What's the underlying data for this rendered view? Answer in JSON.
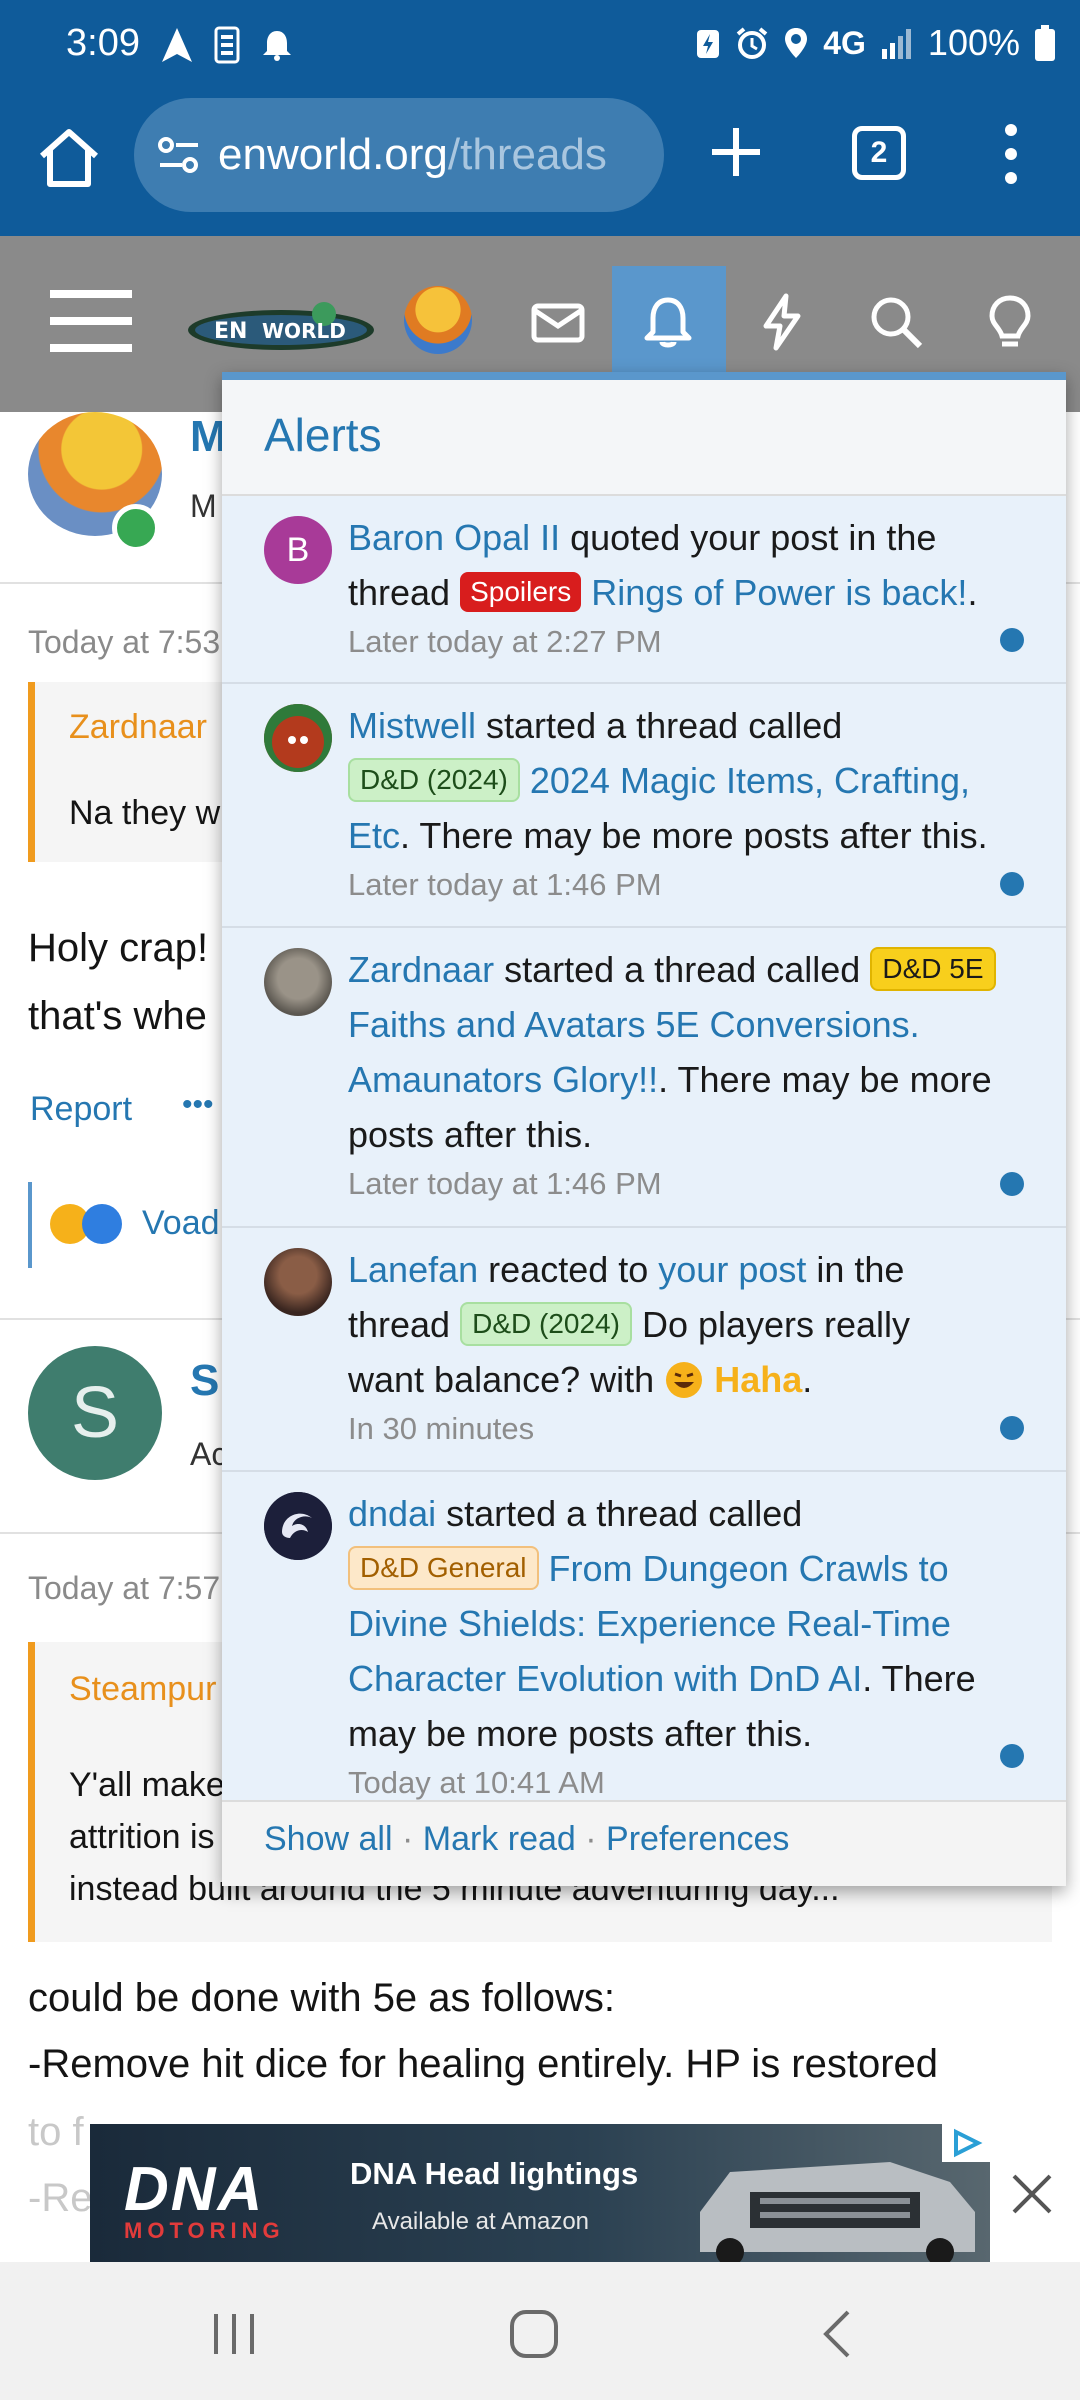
{
  "status_bar": {
    "time": "3:09",
    "network": "4G",
    "battery": "100%"
  },
  "browser": {
    "url_domain": "enworld.org",
    "url_path": "/threads",
    "tab_count": "2"
  },
  "page": {
    "post1": {
      "name_initial": "M",
      "role_initial": "M",
      "time": "Today at 7:53",
      "quote_author": "Zardnaar",
      "quote_text": "Na they w",
      "body_line1": "Holy crap!",
      "body_line2": "that's whe",
      "report_label": "Report",
      "more_label": "•••",
      "reaction_user": "Voad"
    },
    "post2": {
      "avatar_letter": "S",
      "name_initial": "S",
      "role_initial": "Ac",
      "time": "Today at 7:57",
      "quote_author": "Steampur",
      "quote_line1": "Y'all make",
      "quote_line2": "attrition is",
      "quote_line3": "instead built around the 5 minute adventuring day...",
      "body_line1": "could be done with 5e as follows:",
      "body_line2": "-Remove hit dice for healing entirely. HP is restored",
      "body_line3": "to f",
      "body_line4": "-Re"
    }
  },
  "alerts": {
    "title": "Alerts",
    "items": [
      {
        "avatar_letter": "B",
        "user": "Baron Opal II",
        "t1": "quoted your post in the thread",
        "tag": "Spoilers",
        "thread": "Rings of Power is back!",
        "tail": ".",
        "time": "Later today at 2:27 PM"
      },
      {
        "user": "Mistwell",
        "t1": "started a thread called",
        "tag": "D&D (2024)",
        "thread": "2024 Magic Items, Crafting, Etc",
        "tail": ". There may be more posts after this.",
        "time": "Later today at 1:46 PM"
      },
      {
        "user": "Zardnaar",
        "t1": "started a thread called",
        "tag": "D&D 5E",
        "thread": "Faiths and Avatars 5E Conversions. Amaunators Glory!!",
        "tail": ". There may be more posts after this.",
        "time": "Later today at 1:46 PM"
      },
      {
        "user": "Lanefan",
        "t1": "reacted to",
        "post_link": "your post",
        "t2": "in the thread",
        "tag": "D&D (2024)",
        "thread": "Do players really want balance? with",
        "reaction": "Haha",
        "tail": ".",
        "time": "In 30 minutes"
      },
      {
        "user": "dndai",
        "t1": "started a thread called",
        "tag": "D&D General",
        "thread": "From Dungeon Crawls to Divine Shields: Experience Real-Time Character Evolution with DnD AI",
        "tail": ". There may be more posts after this.",
        "time": "Today at 10:41 AM"
      }
    ],
    "footer": {
      "show_all": "Show all",
      "mark_read": "Mark read",
      "preferences": "Preferences",
      "separator": "·"
    }
  },
  "ad": {
    "brand": "DNA",
    "brand_sub": "MOTORING",
    "title": "DNA Head lightings",
    "subtitle": "Available at Amazon"
  },
  "colors": {
    "browser_blue": "#0f5b9a",
    "link_blue": "#2577b1",
    "site_nav_gray": "#8a8a8a",
    "alert_unread_bg": "#e8f1fa"
  }
}
